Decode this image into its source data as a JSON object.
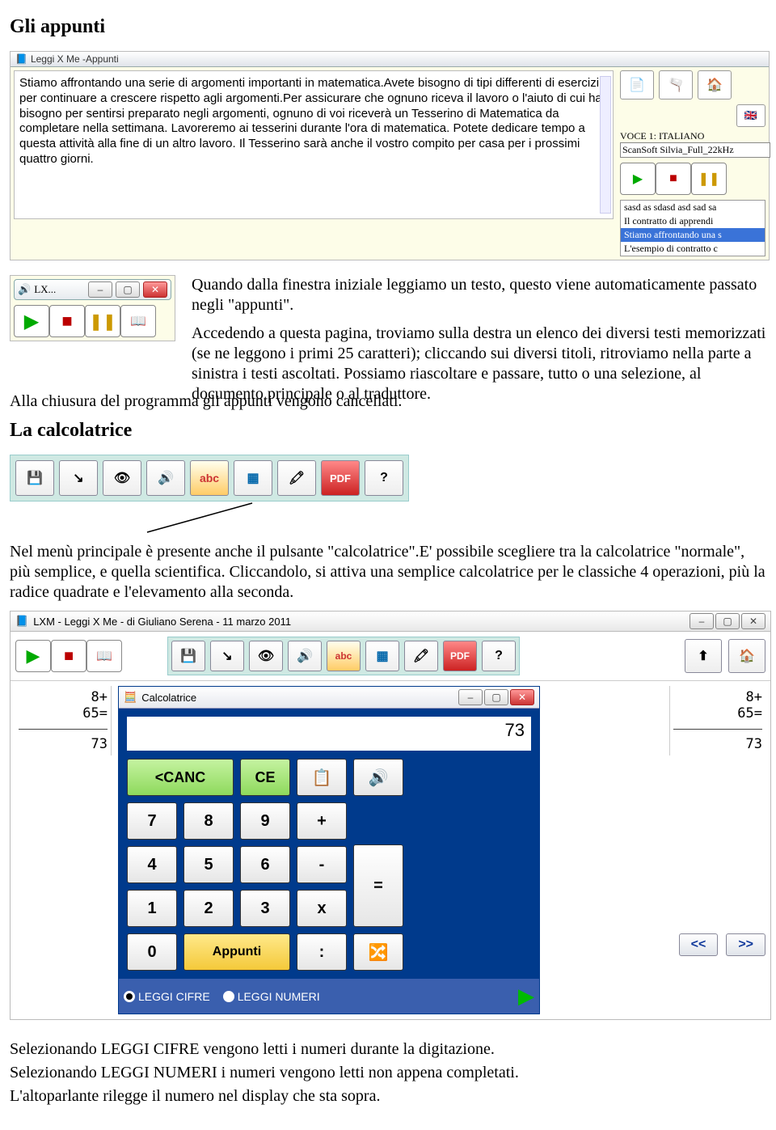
{
  "headings": {
    "appunti": "Gli appunti",
    "calcolatrice": "La calcolatrice"
  },
  "appunti_window": {
    "title": "Leggi X Me -Appunti",
    "text": "Stiamo affrontando una serie di argomenti importanti in matematica.Avete bisogno di tipi differenti di esercizi per continuare a crescere rispetto agli argomenti.Per assicurare che ognuno riceva il lavoro o l'aiuto di cui ha bisogno per sentirsi preparato negli argomenti, ognuno di voi riceverà un Tesserino di Matematica da completare nella settimana. Lavoreremo ai tesserini durante l'ora di matematica. Potete dedicare tempo a questa attività alla fine di un altro lavoro. Il Tesserino sarà anche il vostro compito per casa per i prossimi quattro giorni.",
    "side": {
      "voice_label": "VOCE 1: ITALIANO",
      "voice_value": "ScanSoft Silvia_Full_22kHz",
      "list": [
        "sasd as sdasd asd sad sa",
        "Il contratto di apprendi",
        "Stiamo affrontando una s",
        "L'esempio di contratto c"
      ]
    }
  },
  "lx_taskbar": {
    "title": "LX..."
  },
  "body_text": {
    "p1": "Quando dalla finestra iniziale leggiamo un testo, questo viene automaticamente passato negli \"appunti\".",
    "p2": "Accedendo a questa pagina, troviamo sulla destra un elenco dei diversi testi memorizzati (se ne leggono i primi 25 caratteri); cliccando sui diversi titoli, ritroviamo nella parte a sinistra i testi ascoltati. Possiamo riascoltare e passare, tutto o una selezione, al documento principale o al traduttore.",
    "p3": "Alla chiusura del programma gli appunti vengono cancellati.",
    "p4": "Nel menù principale è presente anche il pulsante \"calcolatrice\".E' possibile scegliere tra la calcolatrice \"normale\", più semplice, e quella scientifica. Cliccandolo, si attiva una semplice calcolatrice per le classiche 4 operazioni, più la radice quadrate e l'elevamento alla seconda.",
    "p5": "Selezionando LEGGI CIFRE vengono letti i numeri durante la digitazione.",
    "p6": "Selezionando LEGGI NUMERI i numeri vengono letti non appena completati.",
    "p7": "L'altoparlante rilegge il numero nel display che sta sopra."
  },
  "toolbar": {
    "abc": "abc",
    "pdf": "PDF",
    "help": "?"
  },
  "lxm_window": {
    "title": "LXM - Leggi X Me - di Giuliano Serena - 11 marzo 2011"
  },
  "calc": {
    "win_title": "Calcolatrice",
    "display": "73",
    "hist_expr": "8+",
    "hist_eq": "65=",
    "hist_result": "73",
    "canc": "<CANC",
    "ce": "CE",
    "keys": {
      "7": "7",
      "8": "8",
      "9": "9",
      "plus": "+",
      "4": "4",
      "5": "5",
      "6": "6",
      "minus": "-",
      "eq": "=",
      "1": "1",
      "2": "2",
      "3": "3",
      "times": "x",
      "0": "0",
      "appunti": "Appunti",
      "div": ":"
    },
    "radio_cifre": "LEGGI CIFRE",
    "radio_numeri": "LEGGI NUMERI",
    "prev": "<<",
    "next": ">>"
  }
}
